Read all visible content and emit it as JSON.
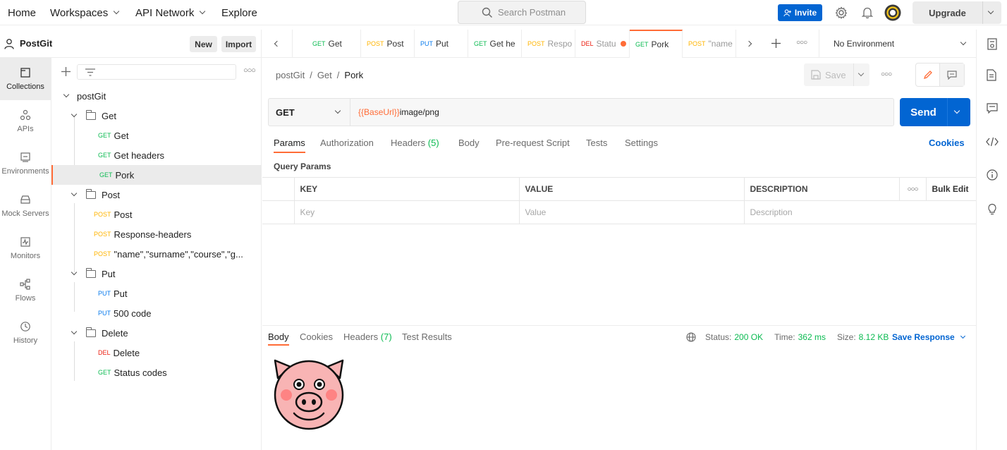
{
  "topbar": {
    "home": "Home",
    "workspaces": "Workspaces",
    "api_network": "API Network",
    "explore": "Explore",
    "search_placeholder": "Search Postman",
    "invite": "Invite",
    "upgrade": "Upgrade"
  },
  "workspace": {
    "name": "PostGit",
    "new": "New",
    "import": "Import"
  },
  "rail": [
    {
      "label": "Collections",
      "icon": "collections-icon"
    },
    {
      "label": "APIs",
      "icon": "apis-icon"
    },
    {
      "label": "Environments",
      "icon": "environments-icon"
    },
    {
      "label": "Mock Servers",
      "icon": "mock-servers-icon"
    },
    {
      "label": "Monitors",
      "icon": "monitors-icon"
    },
    {
      "label": "Flows",
      "icon": "flows-icon"
    },
    {
      "label": "History",
      "icon": "history-icon"
    }
  ],
  "tree": {
    "collection": "postGit",
    "folders": {
      "get": "Get",
      "post": "Post",
      "put": "Put",
      "delete": "Delete"
    },
    "requests": [
      {
        "method": "GET",
        "name": "Get"
      },
      {
        "method": "GET",
        "name": "Get headers"
      },
      {
        "method": "GET",
        "name": "Pork"
      },
      {
        "method": "POST",
        "name": "Post"
      },
      {
        "method": "POST",
        "name": "Response-headers"
      },
      {
        "method": "POST",
        "name": "\"name\",\"surname\",\"course\",\"g..."
      },
      {
        "method": "PUT",
        "name": "Put"
      },
      {
        "method": "PUT",
        "name": "500 code"
      },
      {
        "method": "DEL",
        "name": "Delete"
      },
      {
        "method": "GET",
        "name": "Status codes"
      }
    ]
  },
  "tabs": [
    {
      "method": "GET",
      "name": "Get"
    },
    {
      "method": "POST",
      "name": "Post"
    },
    {
      "method": "PUT",
      "name": "Put"
    },
    {
      "method": "GET",
      "name": "Get he"
    },
    {
      "method": "POST",
      "name": "Respo"
    },
    {
      "method": "DEL",
      "name": "Statu"
    },
    {
      "method": "GET",
      "name": "Pork"
    },
    {
      "method": "POST",
      "name": "\"name"
    }
  ],
  "environment": "No Environment",
  "breadcrumb": {
    "collection": "postGit",
    "folder": "Get",
    "request": "Pork"
  },
  "save": "Save",
  "request": {
    "method": "GET",
    "url_var": "{{BaseUrl}}",
    "url_path": "image/png",
    "send": "Send"
  },
  "request_tabs": {
    "params": "Params",
    "authorization": "Authorization",
    "headers": "Headers",
    "headers_count": "(5)",
    "body": "Body",
    "prerequest": "Pre-request Script",
    "tests": "Tests",
    "settings": "Settings",
    "cookies": "Cookies"
  },
  "query_params": {
    "title": "Query Params",
    "key": "KEY",
    "value": "VALUE",
    "description": "DESCRIPTION",
    "bulk_edit": "Bulk Edit",
    "key_ph": "Key",
    "value_ph": "Value",
    "desc_ph": "Description"
  },
  "response": {
    "body": "Body",
    "cookies": "Cookies",
    "headers": "Headers",
    "headers_count": "(7)",
    "test_results": "Test Results",
    "status_label": "Status:",
    "status_value": "200 OK",
    "time_label": "Time:",
    "time_value": "362 ms",
    "size_label": "Size:",
    "size_value": "8.12 KB",
    "save_response": "Save Response"
  },
  "colors": {
    "accent": "#ff6c37",
    "primary": "#0265d2",
    "get": "#0cbb52",
    "post": "#ffb400",
    "put": "#097bed",
    "del": "#eb2013"
  }
}
